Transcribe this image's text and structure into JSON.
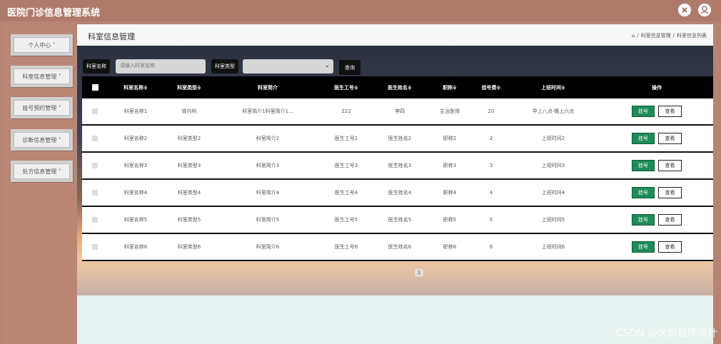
{
  "app": {
    "title": "医院门诊信息管理系统"
  },
  "topbar": {
    "icons": [
      "expand-icon",
      "user-icon"
    ]
  },
  "sidebar": {
    "items": [
      {
        "label": "个人中心 ˅"
      },
      {
        "label": "科室信息管理 ˅"
      },
      {
        "label": "挂号预约管理 ˅"
      },
      {
        "label": "诊断信息管理 ˅"
      },
      {
        "label": "处方信息管理 ˅"
      }
    ]
  },
  "page": {
    "title": "科室信息管理",
    "breadcrumb": [
      "科室信息管理",
      "/",
      "科室信息列表"
    ],
    "breadcrumb_sep": "/"
  },
  "search": {
    "name_label": "科室名称",
    "name_placeholder": "请输入科室名称",
    "type_label": "科室类型",
    "type_value": "",
    "query_label": "查询"
  },
  "table": {
    "headers": [
      "科室名称≑",
      "科室类型≑",
      "科室简介",
      "医生工号≑",
      "医生姓名≑",
      "职称≑",
      "挂号费≑",
      "上班时间≑",
      "操作"
    ],
    "rows": [
      [
        "科室名称1",
        "肾内科",
        "科室简介1科室简介1...",
        "222",
        "李四",
        "主治医师",
        "20",
        "早上八点-晚上六点"
      ],
      [
        "科室名称2",
        "科室类型2",
        "科室简介2",
        "医生工号2",
        "医生姓名2",
        "职称2",
        "2",
        "上班时间2"
      ],
      [
        "科室名称3",
        "科室类型3",
        "科室简介3",
        "医生工号3",
        "医生姓名3",
        "职称3",
        "3",
        "上班时间3"
      ],
      [
        "科室名称4",
        "科室类型4",
        "科室简介4",
        "医生工号4",
        "医生姓名4",
        "职称4",
        "4",
        "上班时间4"
      ],
      [
        "科室名称5",
        "科室类型5",
        "科室简介5",
        "医生工号5",
        "医生姓名5",
        "职称5",
        "5",
        "上班时间5"
      ],
      [
        "科室名称6",
        "科室类型6",
        "科室简介6",
        "医生工号6",
        "医生姓名6",
        "职称6",
        "6",
        "上班时间6"
      ]
    ],
    "actions": {
      "register": "挂号",
      "view": "查看"
    }
  },
  "pagination": {
    "current": "1"
  },
  "watermark": "CSDN @大白程序设计",
  "colors": {
    "topbar": "#ae7b6b",
    "sidebar": "#b98676",
    "register_button": "#1f8c5a"
  }
}
